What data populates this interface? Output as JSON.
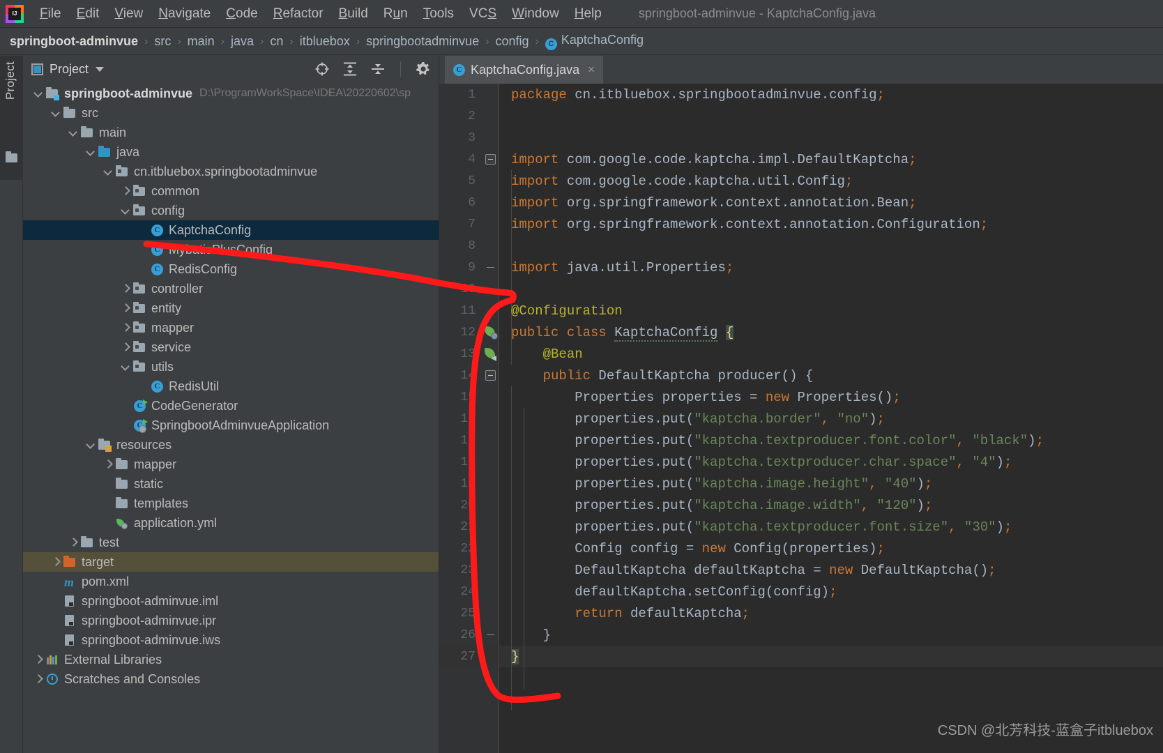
{
  "window": {
    "title": "springboot-adminvue - KaptchaConfig.java"
  },
  "menubar": {
    "items": [
      {
        "label": "File",
        "mnemonic": "F"
      },
      {
        "label": "Edit",
        "mnemonic": "E"
      },
      {
        "label": "View",
        "mnemonic": "V"
      },
      {
        "label": "Navigate",
        "mnemonic": "N"
      },
      {
        "label": "Code",
        "mnemonic": "C"
      },
      {
        "label": "Refactor",
        "mnemonic": "R"
      },
      {
        "label": "Build",
        "mnemonic": "B"
      },
      {
        "label": "Run",
        "mnemonic": "u"
      },
      {
        "label": "Tools",
        "mnemonic": "T"
      },
      {
        "label": "VCS",
        "mnemonic": "S"
      },
      {
        "label": "Window",
        "mnemonic": "W"
      },
      {
        "label": "Help",
        "mnemonic": "H"
      }
    ],
    "logo_text": "IJ"
  },
  "breadcrumb": {
    "items": [
      {
        "label": "springboot-adminvue",
        "bold": true
      },
      {
        "label": "src"
      },
      {
        "label": "main"
      },
      {
        "label": "java"
      },
      {
        "label": "cn"
      },
      {
        "label": "itbluebox"
      },
      {
        "label": "springbootadminvue"
      },
      {
        "label": "config"
      },
      {
        "label": "KaptchaConfig",
        "icon": "class-icon",
        "icon_letter": "C"
      }
    ],
    "separator": "›"
  },
  "toolstrip": {
    "project_label": "Project",
    "folder_icon": "folder-icon"
  },
  "project_panel": {
    "title": "Project",
    "caret": "chevron-down-icon",
    "tools": [
      {
        "name": "locate-icon",
        "tooltip": "Select Opened File"
      },
      {
        "name": "expand-all-icon",
        "tooltip": "Expand All"
      },
      {
        "name": "collapse-all-icon",
        "tooltip": "Collapse All"
      },
      {
        "name": "gear-icon",
        "tooltip": "Settings"
      }
    ],
    "minimize_icon": "minimize-icon",
    "tree": [
      {
        "label": "springboot-adminvue",
        "path": "D:\\ProgramWorkSpace\\IDEA\\20220602\\sp",
        "indent": 0,
        "arrow": "down",
        "icon": "module-folder-icon",
        "bold": true
      },
      {
        "label": "src",
        "indent": 1,
        "arrow": "down",
        "icon": "folder-icon"
      },
      {
        "label": "main",
        "indent": 2,
        "arrow": "down",
        "icon": "folder-icon"
      },
      {
        "label": "java",
        "indent": 3,
        "arrow": "down",
        "icon": "source-folder-icon"
      },
      {
        "label": "cn.itbluebox.springbootadminvue",
        "indent": 4,
        "arrow": "down",
        "icon": "package-icon"
      },
      {
        "label": "common",
        "indent": 5,
        "arrow": "right",
        "icon": "package-icon"
      },
      {
        "label": "config",
        "indent": 5,
        "arrow": "down",
        "icon": "package-icon"
      },
      {
        "label": "KaptchaConfig",
        "indent": 6,
        "arrow": "none",
        "icon": "class-icon",
        "selected": "active"
      },
      {
        "label": "MybatisPlusConfig",
        "indent": 6,
        "arrow": "none",
        "icon": "class-icon"
      },
      {
        "label": "RedisConfig",
        "indent": 6,
        "arrow": "none",
        "icon": "class-icon"
      },
      {
        "label": "controller",
        "indent": 5,
        "arrow": "right",
        "icon": "package-icon"
      },
      {
        "label": "entity",
        "indent": 5,
        "arrow": "right",
        "icon": "package-icon"
      },
      {
        "label": "mapper",
        "indent": 5,
        "arrow": "right",
        "icon": "package-icon"
      },
      {
        "label": "service",
        "indent": 5,
        "arrow": "right",
        "icon": "package-icon"
      },
      {
        "label": "utils",
        "indent": 5,
        "arrow": "down",
        "icon": "package-icon"
      },
      {
        "label": "RedisUtil",
        "indent": 6,
        "arrow": "none",
        "icon": "class-icon"
      },
      {
        "label": "CodeGenerator",
        "indent": 5,
        "arrow": "none",
        "icon": "runnable-class-icon"
      },
      {
        "label": "SpringbootAdminvueApplication",
        "indent": 5,
        "arrow": "none",
        "icon": "spring-class-icon"
      },
      {
        "label": "resources",
        "indent": 3,
        "arrow": "down",
        "icon": "resources-folder-icon"
      },
      {
        "label": "mapper",
        "indent": 4,
        "arrow": "right",
        "icon": "folder-icon"
      },
      {
        "label": "static",
        "indent": 4,
        "arrow": "none",
        "icon": "folder-icon"
      },
      {
        "label": "templates",
        "indent": 4,
        "arrow": "none",
        "icon": "folder-icon"
      },
      {
        "label": "application.yml",
        "indent": 4,
        "arrow": "none",
        "icon": "spring-yaml-icon"
      },
      {
        "label": "test",
        "indent": 2,
        "arrow": "right",
        "icon": "folder-icon"
      },
      {
        "label": "target",
        "indent": 1,
        "arrow": "right",
        "icon": "excluded-folder-icon",
        "selected": "inactive"
      },
      {
        "label": "pom.xml",
        "indent": 1,
        "arrow": "none",
        "icon": "maven-icon"
      },
      {
        "label": "springboot-adminvue.iml",
        "indent": 1,
        "arrow": "none",
        "icon": "iml-file-icon"
      },
      {
        "label": "springboot-adminvue.ipr",
        "indent": 1,
        "arrow": "none",
        "icon": "iml-file-icon"
      },
      {
        "label": "springboot-adminvue.iws",
        "indent": 1,
        "arrow": "none",
        "icon": "iml-file-icon"
      },
      {
        "label": "External Libraries",
        "indent": 0,
        "arrow": "right",
        "icon": "external-libraries-icon"
      },
      {
        "label": "Scratches and Consoles",
        "indent": 0,
        "arrow": "right",
        "icon": "scratches-icon"
      }
    ]
  },
  "editor": {
    "tab": {
      "label": "KaptchaConfig.java",
      "icon_letter": "C",
      "close": "×"
    },
    "lines": [
      {
        "n": 1,
        "segments": [
          {
            "t": "package",
            "c": "kw"
          },
          {
            "t": " cn.itbluebox.springbootadminvue.config",
            "c": ""
          },
          {
            "t": ";",
            "c": "sem"
          }
        ]
      },
      {
        "n": 2,
        "segments": []
      },
      {
        "n": 3,
        "segments": []
      },
      {
        "n": 4,
        "gutter": "fold-start",
        "segments": [
          {
            "t": "import",
            "c": "kw"
          },
          {
            "t": " com.google.code.kaptcha.impl.DefaultKaptcha",
            "c": ""
          },
          {
            "t": ";",
            "c": "sem"
          }
        ]
      },
      {
        "n": 5,
        "segments": [
          {
            "t": "import",
            "c": "kw"
          },
          {
            "t": " com.google.code.kaptcha.util.Config",
            "c": ""
          },
          {
            "t": ";",
            "c": "sem"
          }
        ]
      },
      {
        "n": 6,
        "segments": [
          {
            "t": "import",
            "c": "kw"
          },
          {
            "t": " org.springframework.context.annotation.Bean",
            "c": ""
          },
          {
            "t": ";",
            "c": "sem"
          }
        ]
      },
      {
        "n": 7,
        "segments": [
          {
            "t": "import",
            "c": "kw"
          },
          {
            "t": " org.springframework.context.annotation.Configuration",
            "c": ""
          },
          {
            "t": ";",
            "c": "sem"
          }
        ]
      },
      {
        "n": 8,
        "segments": []
      },
      {
        "n": 9,
        "gutter": "fold-end",
        "segments": [
          {
            "t": "import",
            "c": "kw"
          },
          {
            "t": " java.util.Properties",
            "c": ""
          },
          {
            "t": ";",
            "c": "sem"
          }
        ]
      },
      {
        "n": 10,
        "segments": []
      },
      {
        "n": 11,
        "segments": [
          {
            "t": "@Configuration",
            "c": "ann"
          }
        ]
      },
      {
        "n": 12,
        "gutter": "bean",
        "segments": [
          {
            "t": "public class",
            "c": "kw"
          },
          {
            "t": " ",
            "c": ""
          },
          {
            "t": "KaptchaConfig",
            "c": "typo"
          },
          {
            "t": " ",
            "c": ""
          },
          {
            "t": "{",
            "c": "brace-hl"
          }
        ]
      },
      {
        "n": 13,
        "gutter": "bean-override",
        "segments": [
          {
            "t": "    ",
            "c": ""
          },
          {
            "t": "@Bean",
            "c": "ann"
          }
        ]
      },
      {
        "n": 14,
        "gutter": "fold-start",
        "segments": [
          {
            "t": "    ",
            "c": ""
          },
          {
            "t": "public",
            "c": "kw"
          },
          {
            "t": " DefaultKaptcha producer() {",
            "c": ""
          }
        ]
      },
      {
        "n": 15,
        "segments": [
          {
            "t": "        Properties properties = ",
            "c": ""
          },
          {
            "t": "new",
            "c": "kw"
          },
          {
            "t": " Properties()",
            "c": ""
          },
          {
            "t": ";",
            "c": "sem"
          }
        ]
      },
      {
        "n": 16,
        "segments": [
          {
            "t": "        properties.put(",
            "c": ""
          },
          {
            "t": "\"kaptcha.border\"",
            "c": "str"
          },
          {
            "t": ",",
            "c": "sem"
          },
          {
            "t": " ",
            "c": ""
          },
          {
            "t": "\"no\"",
            "c": "str"
          },
          {
            "t": ")",
            "c": ""
          },
          {
            "t": ";",
            "c": "sem"
          }
        ]
      },
      {
        "n": 17,
        "segments": [
          {
            "t": "        properties.put(",
            "c": ""
          },
          {
            "t": "\"kaptcha.textproducer.font.color\"",
            "c": "str"
          },
          {
            "t": ",",
            "c": "sem"
          },
          {
            "t": " ",
            "c": ""
          },
          {
            "t": "\"black\"",
            "c": "str"
          },
          {
            "t": ")",
            "c": ""
          },
          {
            "t": ";",
            "c": "sem"
          }
        ]
      },
      {
        "n": 18,
        "segments": [
          {
            "t": "        properties.put(",
            "c": ""
          },
          {
            "t": "\"kaptcha.textproducer.char.space\"",
            "c": "str"
          },
          {
            "t": ",",
            "c": "sem"
          },
          {
            "t": " ",
            "c": ""
          },
          {
            "t": "\"4\"",
            "c": "str"
          },
          {
            "t": ")",
            "c": ""
          },
          {
            "t": ";",
            "c": "sem"
          }
        ]
      },
      {
        "n": 19,
        "segments": [
          {
            "t": "        properties.put(",
            "c": ""
          },
          {
            "t": "\"kaptcha.image.height\"",
            "c": "str"
          },
          {
            "t": ",",
            "c": "sem"
          },
          {
            "t": " ",
            "c": ""
          },
          {
            "t": "\"40\"",
            "c": "str"
          },
          {
            "t": ")",
            "c": ""
          },
          {
            "t": ";",
            "c": "sem"
          }
        ]
      },
      {
        "n": 20,
        "segments": [
          {
            "t": "        properties.put(",
            "c": ""
          },
          {
            "t": "\"kaptcha.image.width\"",
            "c": "str"
          },
          {
            "t": ",",
            "c": "sem"
          },
          {
            "t": " ",
            "c": ""
          },
          {
            "t": "\"120\"",
            "c": "str"
          },
          {
            "t": ")",
            "c": ""
          },
          {
            "t": ";",
            "c": "sem"
          }
        ]
      },
      {
        "n": 21,
        "segments": [
          {
            "t": "        properties.put(",
            "c": ""
          },
          {
            "t": "\"kaptcha.textproducer.font.size\"",
            "c": "str"
          },
          {
            "t": ",",
            "c": "sem"
          },
          {
            "t": " ",
            "c": ""
          },
          {
            "t": "\"30\"",
            "c": "str"
          },
          {
            "t": ")",
            "c": ""
          },
          {
            "t": ";",
            "c": "sem"
          }
        ]
      },
      {
        "n": 22,
        "segments": [
          {
            "t": "        Config config = ",
            "c": ""
          },
          {
            "t": "new",
            "c": "kw"
          },
          {
            "t": " Config(properties)",
            "c": ""
          },
          {
            "t": ";",
            "c": "sem"
          }
        ]
      },
      {
        "n": 23,
        "segments": [
          {
            "t": "        DefaultKaptcha defaultKaptcha = ",
            "c": ""
          },
          {
            "t": "new",
            "c": "kw"
          },
          {
            "t": " DefaultKaptcha()",
            "c": ""
          },
          {
            "t": ";",
            "c": "sem"
          }
        ]
      },
      {
        "n": 24,
        "segments": [
          {
            "t": "        defaultKaptcha.setConfig(config)",
            "c": ""
          },
          {
            "t": ";",
            "c": "sem"
          }
        ]
      },
      {
        "n": 25,
        "segments": [
          {
            "t": "        ",
            "c": ""
          },
          {
            "t": "return",
            "c": "kw"
          },
          {
            "t": " defaultKaptcha",
            "c": ""
          },
          {
            "t": ";",
            "c": "sem"
          }
        ]
      },
      {
        "n": 26,
        "gutter": "fold-end",
        "segments": [
          {
            "t": "    }",
            "c": ""
          }
        ]
      },
      {
        "n": 27,
        "current": true,
        "segments": [
          {
            "t": "}",
            "c": "brace-hl"
          }
        ]
      }
    ]
  },
  "watermark": {
    "text": "CSDN @北芳科技-蓝盒子itbluebox"
  },
  "colors": {
    "background": "#3C3F41",
    "editor_background": "#2B2B2B",
    "keyword": "#CC7832",
    "string": "#6A8759",
    "annotation": "#BBB529",
    "identifier": "#A9B7C6",
    "selection_active": "#0D293E",
    "selection_inactive": "#55503A",
    "accent": "#3592C4",
    "annotation_draw": "#FF0000"
  }
}
